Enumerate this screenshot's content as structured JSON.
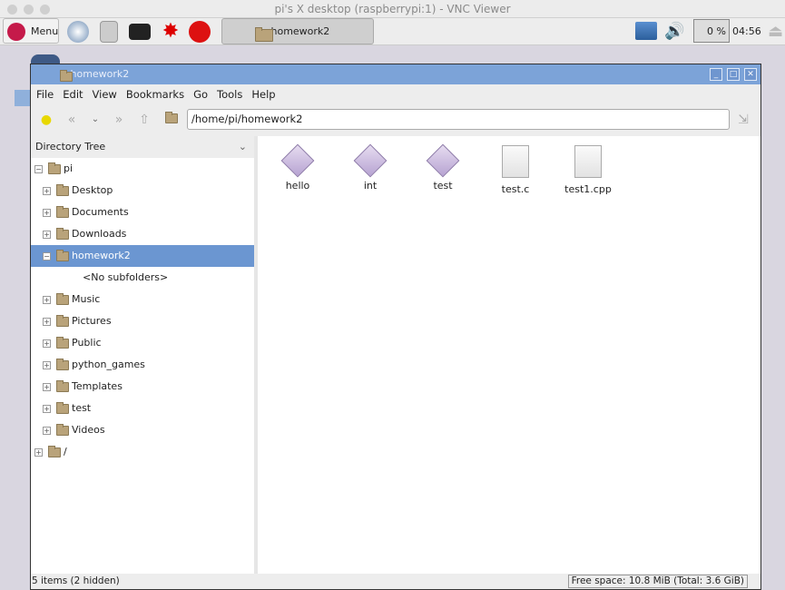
{
  "vnc": {
    "title": "pi's X desktop (raspberrypi:1) - VNC Viewer"
  },
  "taskbar": {
    "menu_label": "Menu",
    "task_label": "homework2",
    "cpu": "0 %",
    "clock": "04:56",
    "launchers": [
      "web-browser-icon",
      "file-manager-icon",
      "terminal-icon",
      "mathematica-icon",
      "wolfram-icon"
    ]
  },
  "window": {
    "title": "homework2",
    "menu": [
      "File",
      "Edit",
      "View",
      "Bookmarks",
      "Go",
      "Tools",
      "Help"
    ],
    "path": "/home/pi/homework2"
  },
  "sidebar": {
    "header": "Directory Tree",
    "root": "pi",
    "items": [
      "Desktop",
      "Documents",
      "Downloads",
      "homework2",
      "Music",
      "Pictures",
      "Public",
      "python_games",
      "Templates",
      "test",
      "Videos"
    ],
    "selected": "homework2",
    "no_subfolders": "<No subfolders>",
    "fs_root": "/"
  },
  "files": [
    {
      "name": "hello",
      "type": "executable"
    },
    {
      "name": "int",
      "type": "executable"
    },
    {
      "name": "test",
      "type": "executable"
    },
    {
      "name": "test.c",
      "type": "text"
    },
    {
      "name": "test1.cpp",
      "type": "text"
    }
  ],
  "status": {
    "items": "5 items (2 hidden)",
    "free": "Free space: 10.8 MiB (Total: 3.6 GiB)"
  },
  "colors": {
    "titlebar": "#7ca3d8",
    "selection": "#6b96d1"
  }
}
